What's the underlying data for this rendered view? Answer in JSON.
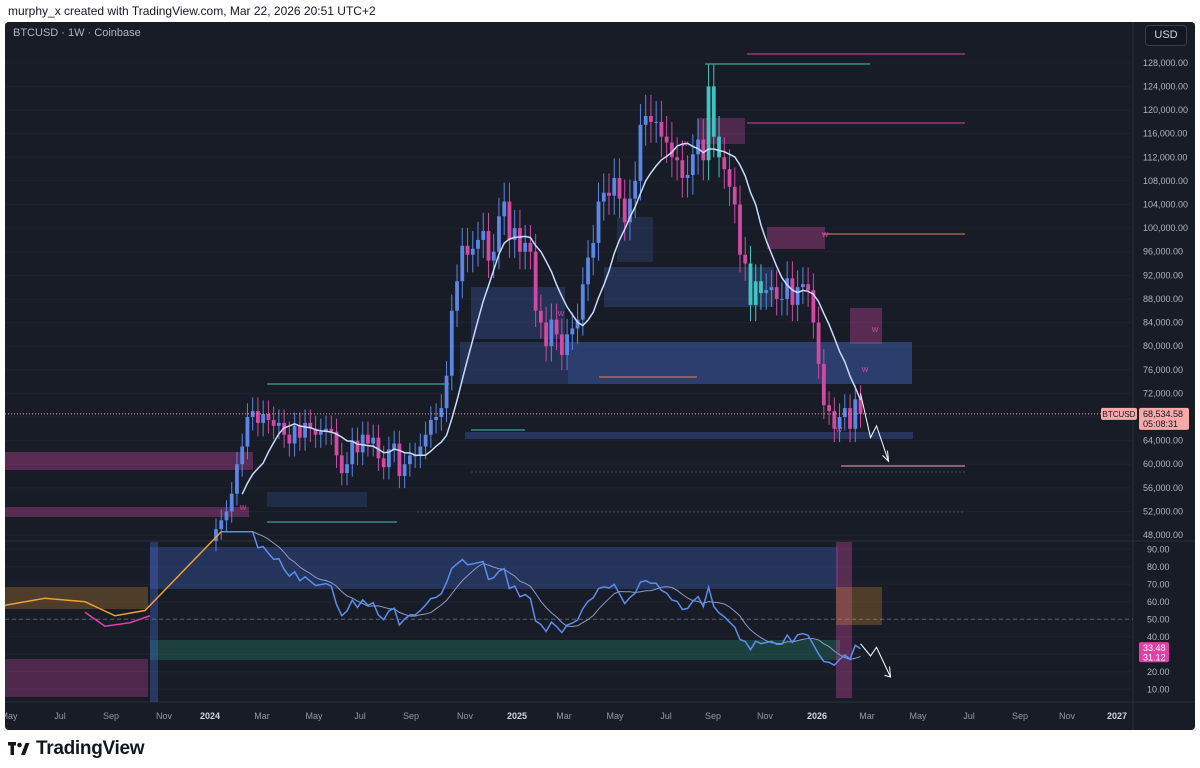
{
  "header": {
    "caption": "murphy_x created with TradingView.com, Mar 22, 2026 20:51 UTC+2"
  },
  "chart_header": {
    "symbol": "BTCUSD · 1W · Coinbase",
    "currency_button": "USD"
  },
  "footer": {
    "brand": "TradingView"
  },
  "colors": {
    "bull": "#5b86e5",
    "bear": "#d04aa4",
    "highlight_bull": "#3fc5c1",
    "ma": "#c8dcff",
    "rsi_blue": "#5b8ef0",
    "rsi_teal": "#2bb39a",
    "rsi_pink": "#e040a8",
    "rsi_orange": "#f0a030",
    "price_tag": "#f7a8a8"
  },
  "chart_data": [
    {
      "type": "candlestick",
      "title": "BTCUSD · 1W · Coinbase",
      "y_axis_labels": [
        "128,000.00",
        "124,000.00",
        "120,000.00",
        "116,000.00",
        "112,000.00",
        "108,000.00",
        "104,000.00",
        "100,000.00",
        "96,000.00",
        "92,000.00",
        "88,000.00",
        "84,000.00",
        "80,000.00",
        "76,000.00",
        "72,000.00",
        "68,000.00",
        "64,000.00",
        "60,000.00",
        "56,000.00",
        "52,000.00",
        "48,000.00"
      ],
      "ylim": [
        47500,
        129500
      ],
      "x_axis_labels": [
        "May",
        "Jul",
        "Sep",
        "Nov",
        "2024",
        "Mar",
        "May",
        "Jul",
        "Sep",
        "Nov",
        "2025",
        "Mar",
        "May",
        "Jul",
        "Sep",
        "Nov",
        "2026",
        "Mar",
        "May",
        "Jul",
        "Sep",
        "Nov",
        "2027"
      ],
      "current_price": {
        "label": "BTCUSD",
        "price": "68,534.58",
        "countdown": "05:08:31",
        "value": 68534.58
      },
      "closes": [
        49000,
        50500,
        52000,
        55000,
        60000,
        63000,
        68000,
        69000,
        67000,
        68500,
        67500,
        66500,
        67000,
        65000,
        63500,
        66500,
        64500,
        67000,
        66000,
        65000,
        65500,
        66000,
        65500,
        61500,
        58500,
        60000,
        64000,
        62000,
        65000,
        63500,
        64500,
        61000,
        59500,
        62500,
        63500,
        58000,
        60000,
        61500,
        61500,
        63000,
        65000,
        67500,
        68000,
        69500,
        75000,
        86000,
        91000,
        97000,
        95500,
        96500,
        98000,
        99500,
        94500,
        96000,
        102000,
        104500,
        98000,
        100000,
        96000,
        97500,
        96000,
        86000,
        84000,
        80000,
        84500,
        82000,
        78500,
        82000,
        83000,
        84500,
        90500,
        95000,
        97500,
        104500,
        106000,
        105500,
        108500,
        105000,
        101000,
        105000,
        108000,
        117500,
        119000,
        118000,
        118000,
        115500,
        114500,
        112000,
        111500,
        108500,
        109000,
        112500,
        115000,
        111500,
        124000,
        115500,
        112000,
        110000,
        107000,
        104000,
        95500,
        94000,
        87000,
        91000,
        89000,
        89500,
        90000,
        88000,
        88000,
        91500,
        87000,
        90000,
        90500,
        89500,
        84000,
        77000,
        70000,
        69000,
        66000,
        68000,
        69500,
        66000,
        71000,
        68534.58
      ],
      "rsi": {
        "y_axis_labels": [
          "90.00",
          "80.00",
          "70.00",
          "60.00",
          "50.00",
          "40.00",
          "30.00",
          "20.00",
          "10.00"
        ],
        "ylim": [
          5,
          93
        ],
        "current_values": [
          "33.48",
          "31.12"
        ]
      },
      "annotations": [
        "W",
        "W",
        "W",
        "W",
        "W",
        "W",
        "W"
      ]
    }
  ]
}
